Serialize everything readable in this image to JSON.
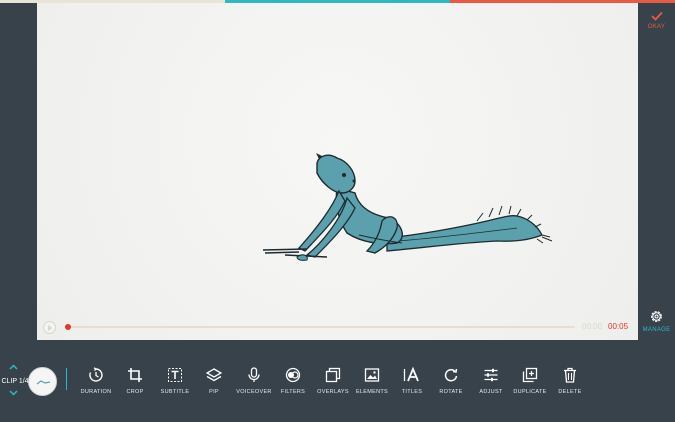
{
  "progress_bar": {
    "segments": [
      "#e8e4d6",
      "#2fb8c4",
      "#e85a47"
    ]
  },
  "header_right": {
    "okay_label": "OKAY",
    "manage_label": "MANAGE"
  },
  "player": {
    "current_time": "00:00",
    "total_time": "00:05",
    "progress": 0.0
  },
  "clip_nav": {
    "label": "CLIP 1/4"
  },
  "tools": [
    {
      "label": "DURATION",
      "icon": "timer-icon"
    },
    {
      "label": "CROP",
      "icon": "crop-icon"
    },
    {
      "label": "SUBTITLE",
      "icon": "subtitle-icon"
    },
    {
      "label": "PIP",
      "icon": "layers-icon"
    },
    {
      "label": "VOICEOVER",
      "icon": "microphone-icon"
    },
    {
      "label": "FILTERS",
      "icon": "filters-icon"
    },
    {
      "label": "OVERLAYS",
      "icon": "overlays-icon"
    },
    {
      "label": "ELEMENTS",
      "icon": "image-icon"
    },
    {
      "label": "TITLES",
      "icon": "text-icon"
    },
    {
      "label": "ROTATE",
      "icon": "rotate-icon"
    },
    {
      "label": "ADJUST",
      "icon": "sliders-icon"
    },
    {
      "label": "DUPLICATE",
      "icon": "duplicate-icon"
    },
    {
      "label": "DELETE",
      "icon": "trash-icon"
    }
  ],
  "colors": {
    "accent": "#2fb8c4",
    "danger": "#e85a47",
    "panel": "#37424b"
  }
}
